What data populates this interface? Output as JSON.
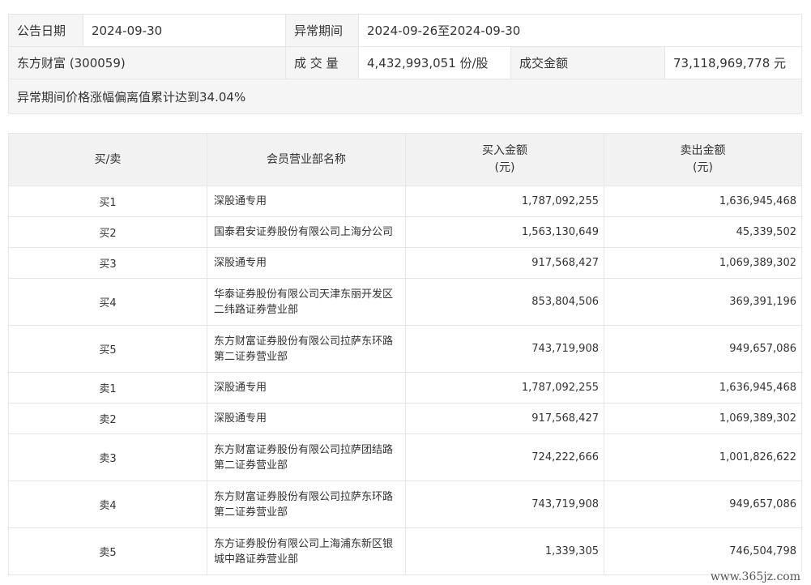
{
  "info": {
    "announce_date_label": "公告日期",
    "announce_date": "2024-09-30",
    "abnormal_period_label": "异常期间",
    "abnormal_period": "2024-09-26至2024-09-30",
    "stock": "东方财富 (300059)",
    "volume_label": "成 交 量",
    "volume": "4,432,993,051 份/股",
    "amount_label": "成交金额",
    "amount": "73,118,969,778 元",
    "reason": "异常期间价格涨幅偏离值累计达到34.04%"
  },
  "table": {
    "headers": {
      "side": "买/卖",
      "dept": "会员营业部名称",
      "buy": "买入金额",
      "buy_unit": "(元)",
      "sell": "卖出金额",
      "sell_unit": "(元)"
    },
    "rows": [
      {
        "side": "买1",
        "dept_l1": "深股通专用",
        "dept_l2": "",
        "buy": "1,787,092,255",
        "sell": "1,636,945,468"
      },
      {
        "side": "买2",
        "dept_l1": "国泰君安证券股份有限公司上海分公司",
        "dept_l2": "",
        "buy": "1,563,130,649",
        "sell": "45,339,502"
      },
      {
        "side": "买3",
        "dept_l1": "深股通专用",
        "dept_l2": "",
        "buy": "917,568,427",
        "sell": "1,069,389,302"
      },
      {
        "side": "买4",
        "dept_l1": "华泰证券股份有限公司天津东丽开发区",
        "dept_l2": "二纬路证券营业部",
        "buy": "853,804,506",
        "sell": "369,391,196"
      },
      {
        "side": "买5",
        "dept_l1": "东方财富证券股份有限公司拉萨东环路",
        "dept_l2": "第二证券营业部",
        "buy": "743,719,908",
        "sell": "949,657,086"
      },
      {
        "side": "卖1",
        "dept_l1": "深股通专用",
        "dept_l2": "",
        "buy": "1,787,092,255",
        "sell": "1,636,945,468"
      },
      {
        "side": "卖2",
        "dept_l1": "深股通专用",
        "dept_l2": "",
        "buy": "917,568,427",
        "sell": "1,069,389,302"
      },
      {
        "side": "卖3",
        "dept_l1": "东方财富证券股份有限公司拉萨团结路",
        "dept_l2": "第二证券营业部",
        "buy": "724,222,666",
        "sell": "1,001,826,622"
      },
      {
        "side": "卖4",
        "dept_l1": "东方财富证券股份有限公司拉萨东环路",
        "dept_l2": "第二证券营业部",
        "buy": "743,719,908",
        "sell": "949,657,086"
      },
      {
        "side": "卖5",
        "dept_l1": "东方证券股份有限公司上海浦东新区银",
        "dept_l2": "城中路证券营业部",
        "buy": "1,339,305",
        "sell": "746,504,798"
      }
    ]
  },
  "watermark": "www.365jz.com"
}
